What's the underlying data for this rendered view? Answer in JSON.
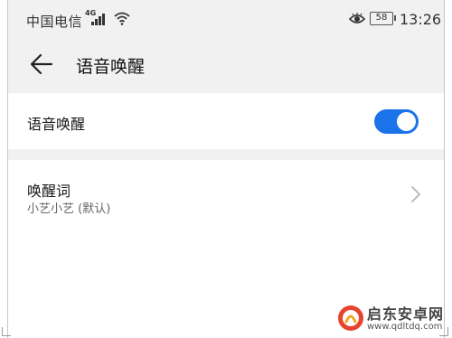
{
  "status_bar": {
    "carrier": "中国电信",
    "network": "4G",
    "battery": "58",
    "time": "13:26"
  },
  "header": {
    "title": "语音唤醒",
    "back_icon": "arrow-left-icon"
  },
  "settings": {
    "voice_wakeup": {
      "label": "语音唤醒",
      "enabled": true
    },
    "wake_word": {
      "title": "唤醒词",
      "value": "小艺小艺 (默认)"
    }
  },
  "colors": {
    "accent": "#1a73e8",
    "header_bg": "#f1f1f1",
    "watermark_red": "#e8432e"
  },
  "watermark": {
    "name": "启东安卓网",
    "url": "www.qdltdq.com"
  }
}
